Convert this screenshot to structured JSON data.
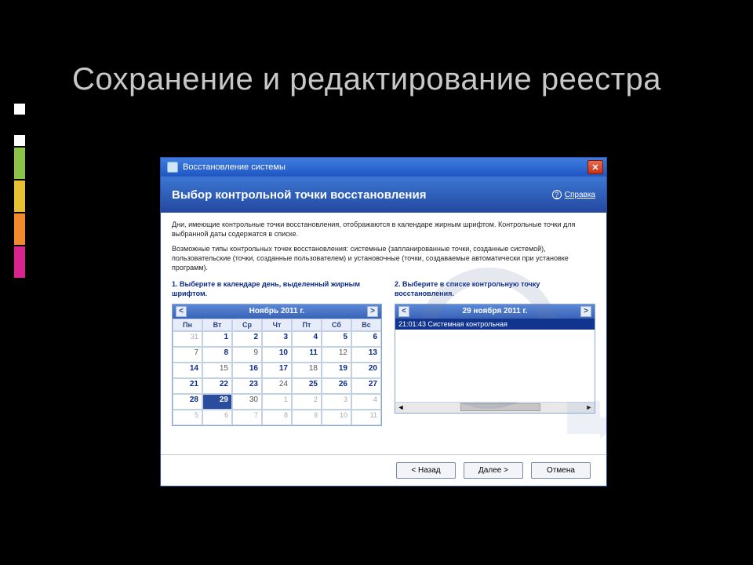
{
  "slide_title": "Сохранение и редактирование реестра",
  "window": {
    "title": "Восстановление системы",
    "help": "Справка"
  },
  "banner_title": "Выбор контрольной точки восстановления",
  "desc1": "Дни, имеющие контрольные точки восстановления, отображаются в календаре жирным шрифтом. Контрольные точки для выбранной даты содержатся в списке.",
  "desc2": "Возможные типы контрольных точек восстановления: системные (запланированные точки, созданные системой), пользовательские (точки, созданные пользователем) и установочные (точки, создаваемые автоматически при установке программ).",
  "step1": "1. Выберите в календаре день, выделенный жирным шрифтом.",
  "step2": "2. Выберите в списке контрольную точку восстановления.",
  "calendar": {
    "prev": "<",
    "next": ">",
    "month": "Ноябрь 2011 г.",
    "dow": [
      "Пн",
      "Вт",
      "Ср",
      "Чт",
      "Пт",
      "Сб",
      "Вс"
    ],
    "cells": [
      {
        "v": "31",
        "cls": "muted"
      },
      {
        "v": "1",
        "cls": "bold"
      },
      {
        "v": "2",
        "cls": "bold"
      },
      {
        "v": "3",
        "cls": "bold"
      },
      {
        "v": "4",
        "cls": "bold"
      },
      {
        "v": "5",
        "cls": "bold"
      },
      {
        "v": "6",
        "cls": "bold"
      },
      {
        "v": "7",
        "cls": ""
      },
      {
        "v": "8",
        "cls": "bold"
      },
      {
        "v": "9",
        "cls": ""
      },
      {
        "v": "10",
        "cls": "bold"
      },
      {
        "v": "11",
        "cls": "bold"
      },
      {
        "v": "12",
        "cls": ""
      },
      {
        "v": "13",
        "cls": "bold"
      },
      {
        "v": "14",
        "cls": "bold"
      },
      {
        "v": "15",
        "cls": ""
      },
      {
        "v": "16",
        "cls": "bold"
      },
      {
        "v": "17",
        "cls": "bold"
      },
      {
        "v": "18",
        "cls": ""
      },
      {
        "v": "19",
        "cls": "bold"
      },
      {
        "v": "20",
        "cls": "bold"
      },
      {
        "v": "21",
        "cls": "bold"
      },
      {
        "v": "22",
        "cls": "bold"
      },
      {
        "v": "23",
        "cls": "bold"
      },
      {
        "v": "24",
        "cls": ""
      },
      {
        "v": "25",
        "cls": "bold"
      },
      {
        "v": "26",
        "cls": "bold"
      },
      {
        "v": "27",
        "cls": "bold"
      },
      {
        "v": "28",
        "cls": "bold"
      },
      {
        "v": "29",
        "cls": "sel"
      },
      {
        "v": "30",
        "cls": ""
      },
      {
        "v": "1",
        "cls": "muted"
      },
      {
        "v": "2",
        "cls": "muted"
      },
      {
        "v": "3",
        "cls": "muted"
      },
      {
        "v": "4",
        "cls": "muted"
      },
      {
        "v": "5",
        "cls": "muted"
      },
      {
        "v": "6",
        "cls": "muted"
      },
      {
        "v": "7",
        "cls": "muted"
      },
      {
        "v": "8",
        "cls": "muted"
      },
      {
        "v": "9",
        "cls": "muted"
      },
      {
        "v": "10",
        "cls": "muted"
      },
      {
        "v": "11",
        "cls": "muted"
      }
    ]
  },
  "listhead": "29 ноября 2011 г.",
  "listitem": "21:01:43 Системная контрольная",
  "buttons": {
    "back": "< Назад",
    "next": "Далее >",
    "cancel": "Отмена"
  },
  "decor_colors": [
    "#000000",
    "#ffffff",
    "#000000",
    "#ffffff",
    "#8bc34a",
    "#e8c132",
    "#f08a2c",
    "#d9248d"
  ],
  "decor_heights": [
    70,
    14,
    22,
    14,
    40,
    40,
    40,
    40
  ]
}
